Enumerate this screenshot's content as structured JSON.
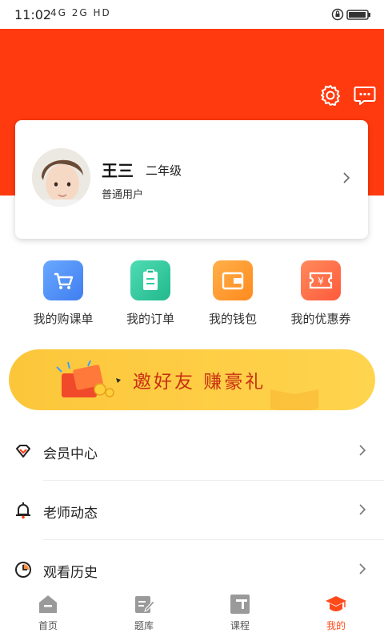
{
  "status_bar": {
    "time": "11:02",
    "signals": "4G 2G HD"
  },
  "header": {
    "settings_icon": "gear-icon",
    "message_icon": "chat-bubble-icon"
  },
  "profile": {
    "name": "王三",
    "grade": "二年级",
    "user_type": "普通用户"
  },
  "quick_actions": [
    {
      "label": "我的购课单",
      "icon": "cart-icon",
      "color": "#4f8ff5"
    },
    {
      "label": "我的订单",
      "icon": "clipboard-icon",
      "color": "#35c9a0"
    },
    {
      "label": "我的钱包",
      "icon": "wallet-icon",
      "color": "#ff9a2e"
    },
    {
      "label": "我的优惠券",
      "icon": "coupon-icon",
      "color": "#ff6a4a"
    }
  ],
  "banner": {
    "text": "邀好友 赚豪礼"
  },
  "menu": [
    {
      "label": "会员中心",
      "icon": "vip-diamond-icon"
    },
    {
      "label": "老师动态",
      "icon": "bell-icon"
    },
    {
      "label": "观看历史",
      "icon": "clock-icon"
    }
  ],
  "tabs": [
    {
      "label": "首页",
      "icon": "home-icon",
      "active": false
    },
    {
      "label": "题库",
      "icon": "edit-doc-icon",
      "active": false
    },
    {
      "label": "课程",
      "icon": "course-icon",
      "active": false
    },
    {
      "label": "我的",
      "icon": "graduation-cap-icon",
      "active": true
    }
  ],
  "colors": {
    "accent": "#ff3a0f",
    "tab_active": "#ff4a1a",
    "tab_inactive": "#9a9a9a",
    "banner": "#fcc63a"
  }
}
